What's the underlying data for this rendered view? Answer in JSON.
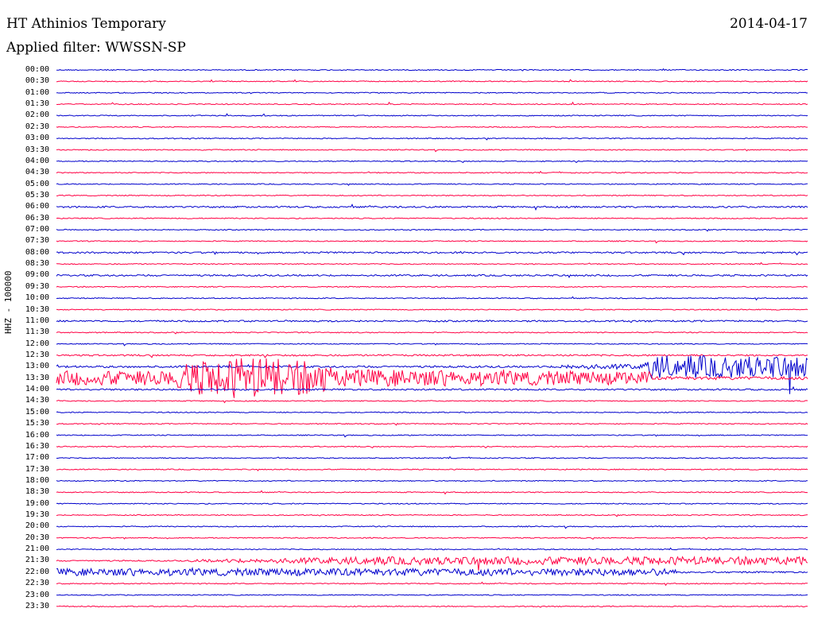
{
  "header": {
    "station": "HT Athinios Temporary",
    "date": "2014-04-17",
    "filter": "Applied filter: WWSSN-SP",
    "channel": "HHZ - 100000"
  },
  "colors": {
    "blue": "#0000cc",
    "red": "#ff0044",
    "text": "#000000"
  },
  "times": [
    "00:00",
    "00:30",
    "01:00",
    "01:30",
    "02:00",
    "02:30",
    "03:00",
    "03:30",
    "04:00",
    "04:30",
    "05:00",
    "05:30",
    "06:00",
    "06:30",
    "07:00",
    "07:30",
    "08:00",
    "08:30",
    "09:00",
    "09:30",
    "10:00",
    "10:30",
    "11:00",
    "11:30",
    "12:00",
    "12:30",
    "13:00",
    "13:30",
    "14:00",
    "14:30",
    "15:00",
    "15:30",
    "16:00",
    "16:30",
    "17:00",
    "17:30",
    "18:00",
    "18:30",
    "19:00",
    "19:30",
    "20:00",
    "20:30",
    "21:00",
    "21:30",
    "22:00",
    "22:30",
    "23:00",
    "23:30"
  ]
}
